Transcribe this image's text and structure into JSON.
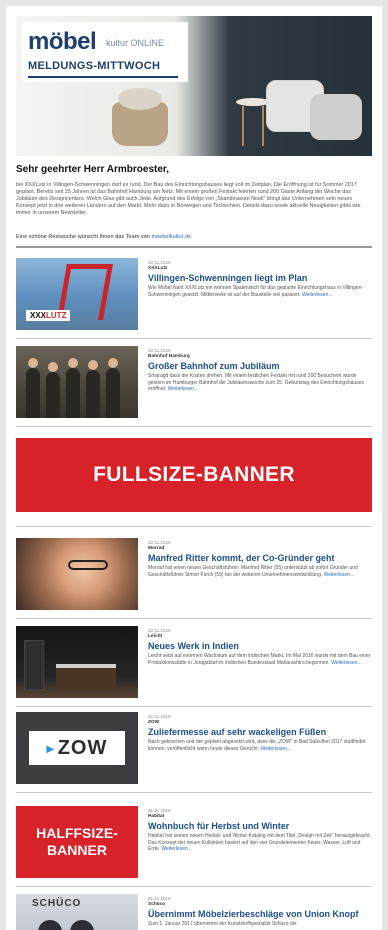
{
  "header": {
    "logo_main": "möbel",
    "logo_sub": "kultur ONLINE",
    "logo_line": "MELDUNGS-MITTWOCH"
  },
  "greeting": "Sehr geehrter Herr Armbroester,",
  "intro": "bei XXXLutz in Villingen-Schwenningen darf es rund. Der Bau des Einrichtungshauses liegt voll im Zeitplan. Die Eröffnung ist für Sommer 2017 geplant. Bereits seit 25 Jahren ist das Bahnhof Hamburg am Netz. Mit einem großen Festakt feierten rund 200 Gäste Anfang der Woche das Jubiläum des Designcenters. Welch Glas gibt auch Jede. Aufgrund des Erfolgs von „Skandinavian Noeli“ bringt das Unternehmen sein neues Konzept jetzt in drei weiteren Ländern auf den Markt. Mehr dazu in Norwegen und Tschechien. Details dazu sowie aktuelle Neuigkeiten gibts wie immer in unserem Newsletter.",
  "signoff": {
    "text": "Eine schöne Restwoche wünscht Ihnen das Team von",
    "link": "moebelkultur.de"
  },
  "articles": [
    {
      "date": "22.11.2016",
      "category": "XXXLutz",
      "title": "Villingen-Schwenningen liegt im Plan",
      "teaser": "Wie Möbel Naht XXXLutz ein wohnen Spatenstich für das geplante Einrichtungshaus in Villingen-Schwenningen gesetzt. Mittlerweile ist auf der Baustelle viel passiert.",
      "more": "Weiterlesen..."
    },
    {
      "date": "22.11.2016",
      "category": "Bahnhof Hamburg",
      "title": "Großer Bahnhof zum Jubiläum",
      "teaser": "Smaragd dass die Kosten drehen. Mit einem festlichen Festakt mit rund 200 Besuchern wurde gestern im Hamburger Bahnhof die Jubiläumswoche zum 25. Geburtstag des Einrichtungshauses eröffnet.",
      "more": "Weiterlesen..."
    },
    {
      "date": "22.11.2016",
      "category": "Morrad",
      "title": "Manfred Ritter kommt, der Co-Gründer geht",
      "teaser": "Morrad hat einen neuen Geschäftsführer: Manfred Ritter (55) unterstützt ab sofort Gründer und Geschäftsführer Simon Fürch (59) bei der weiteren Unternehmensentwicklung.",
      "more": "Weiterlesen..."
    },
    {
      "date": "22.11.2016",
      "category": "Leicht",
      "title": "Neues Werk in Indien",
      "teaser": "Leicht setzt auf externen Wachstum auf dem indischen Markt. Im Mai 2016 wurde mit dem Bau einer Produktionsstätte in Joragabad im indischen Bundesstaat Maharashtra begonnen.",
      "more": "Weiterlesen..."
    },
    {
      "date": "22.11.2016",
      "category": "ZOW",
      "title": "Zuliefermesse auf sehr wackeligen Füßen",
      "teaser": "Nach gebrochen und der geplant abgesetzt wird, dass die „ZOW“ in Bad Salzuflen 2017 stattfindet können, veröffentlicht wenn heute dieses Gerücht.",
      "more": "Weiterlesen..."
    },
    {
      "date": "21.11.2016",
      "category": "Habitat",
      "title": "Wohnbuch für Herbst und Winter",
      "teaser": "Habitat hat seinen neuen Herbst- und Winter-Katalog mit dem Titel „Design mit Zeit“ herausgebracht. Das Konzept der neuen Kollektion basiert auf den vier Grundelementen Feuer, Wasser, Luft und Erde.",
      "more": "Weiterlesen..."
    },
    {
      "date": "21.11.2016",
      "category": "Schüco",
      "title": "Übernimmt Möbelzierbeschläge von Union Knopf",
      "teaser": "Zum 1. Januar 2017 übernimmt der Kunststoffspezialist Schüco die",
      "more": ""
    }
  ],
  "banners": {
    "full": "FULLSIZE-BANNER",
    "half_line1": "HALFFSIZE-",
    "half_line2": "BANNER"
  },
  "thumbs": {
    "xxxl_logo_a": "XXX",
    "xxxl_logo_b": "LUTZ",
    "zow_mark": "▸",
    "zow_word": "ZOW",
    "schueco_logo": "SCHÜCO"
  }
}
